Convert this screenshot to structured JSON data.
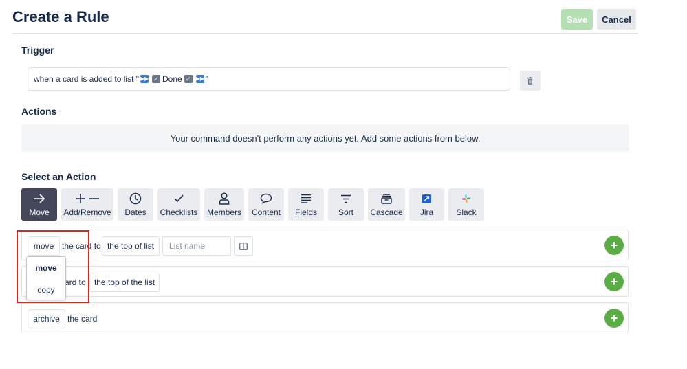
{
  "header": {
    "title": "Create a Rule",
    "save_label": "Save",
    "cancel_label": "Cancel"
  },
  "trigger": {
    "label": "Trigger",
    "text_before": "when a card is added to list \"",
    "list_name": "Done",
    "text_after": "\""
  },
  "actions": {
    "label": "Actions",
    "empty_message": "Your command doesn't perform any actions yet. Add some actions from below."
  },
  "select_action": {
    "label": "Select an Action",
    "tabs": [
      {
        "label": "Move",
        "icon": "arrow-right-icon"
      },
      {
        "label": "Add/Remove",
        "icon": "plus-minus-icon"
      },
      {
        "label": "Dates",
        "icon": "clock-icon"
      },
      {
        "label": "Checklists",
        "icon": "checkmark-icon"
      },
      {
        "label": "Members",
        "icon": "person-icon"
      },
      {
        "label": "Content",
        "icon": "speech-bubble-icon"
      },
      {
        "label": "Fields",
        "icon": "lines-icon"
      },
      {
        "label": "Sort",
        "icon": "sort-icon"
      },
      {
        "label": "Cascade",
        "icon": "archive-box-icon"
      },
      {
        "label": "Jira",
        "icon": "jira-icon"
      },
      {
        "label": "Slack",
        "icon": "slack-icon"
      }
    ]
  },
  "rows": [
    {
      "verb": "move",
      "middle": "the card to",
      "position": "the top of list",
      "list_placeholder": "List name"
    },
    {
      "middle": "ard to",
      "position": "the top of the list"
    },
    {
      "verb": "archive",
      "middle": "the card"
    }
  ],
  "dropdown": {
    "options": [
      "move",
      "copy"
    ],
    "selected": "move"
  },
  "colors": {
    "accent_green": "#5aac44",
    "save_disabled": "#b3dfb3",
    "active_tab": "#44475a",
    "highlight": "#e0251b"
  }
}
